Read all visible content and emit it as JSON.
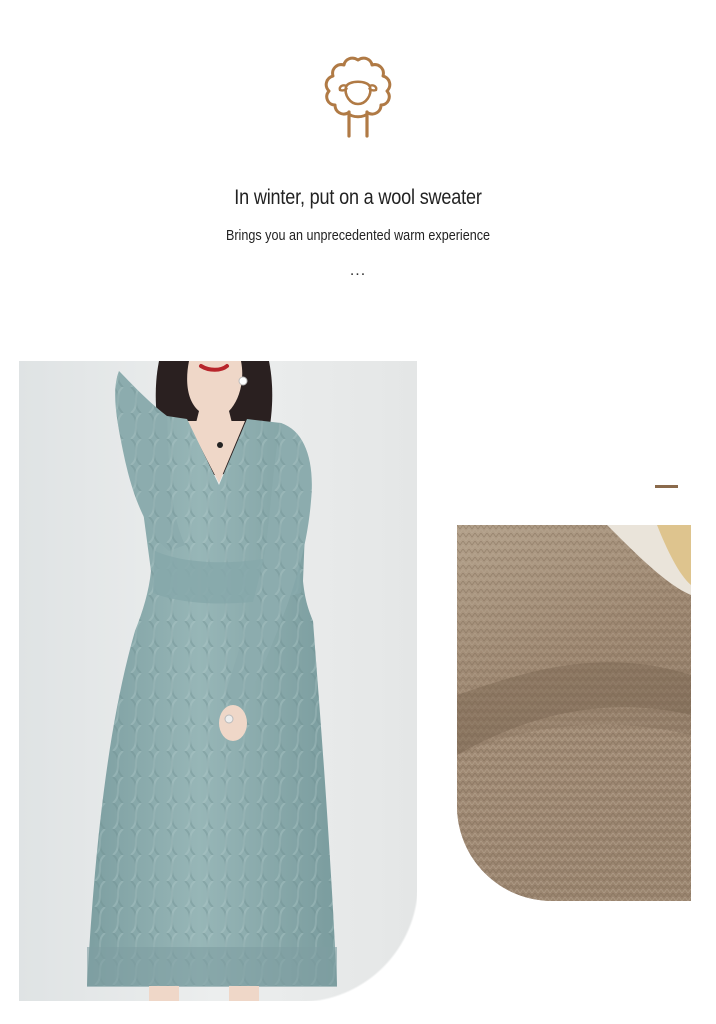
{
  "headline": "In winter, put on a wool sweater",
  "subline": "Brings you an unprecedented warm experience",
  "dots": "...",
  "icons": {
    "logo": "sheep-icon"
  },
  "images": {
    "main": "woman-in-light-blue-cable-knit-sweater-dress",
    "detail": "close-up-of-beige-knit-fabric"
  },
  "colors": {
    "accent": "#8a6a4c",
    "logo": "#b07a45",
    "dress": "#8fb0b1",
    "fabric": "#a38e77"
  }
}
